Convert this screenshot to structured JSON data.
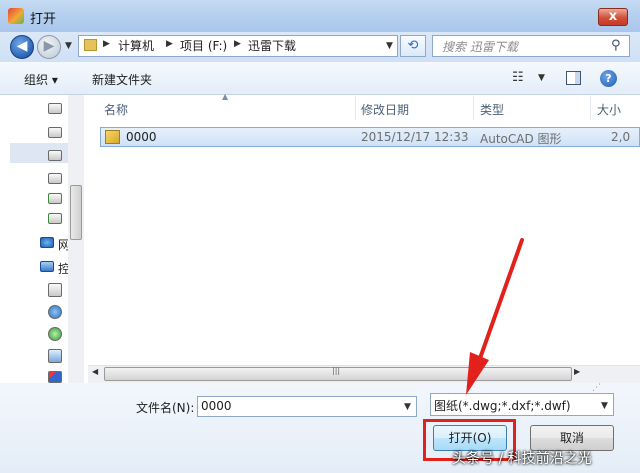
{
  "window": {
    "title": "打开",
    "close_glyph": "x"
  },
  "address": {
    "breadcrumb": [
      "计算机",
      "项目 (F:)",
      "迅雷下载"
    ],
    "search_placeholder": "搜索 迅雷下载"
  },
  "toolbar": {
    "organize_label": "组织 ▾",
    "new_folder_label": "新建文件夹"
  },
  "nav": {
    "items": [
      "网",
      "控"
    ]
  },
  "list": {
    "columns": [
      "名称",
      "修改日期",
      "类型",
      "大小"
    ],
    "rows": [
      {
        "name": "0000",
        "date": "2015/12/17 12:33",
        "type": "AutoCAD 图形",
        "size": "2,0"
      }
    ]
  },
  "bottom": {
    "filename_label": "文件名(N):",
    "filename_value": "0000",
    "filter_value": "图纸(*.dwg;*.dxf;*.dwf)",
    "open_label": "打开(O)",
    "cancel_label": "取消"
  },
  "watermark": "头条号 / 科技前沿之光",
  "colors": {
    "annotation_red": "#e2201c",
    "accent_blue": "#2a62b8"
  }
}
